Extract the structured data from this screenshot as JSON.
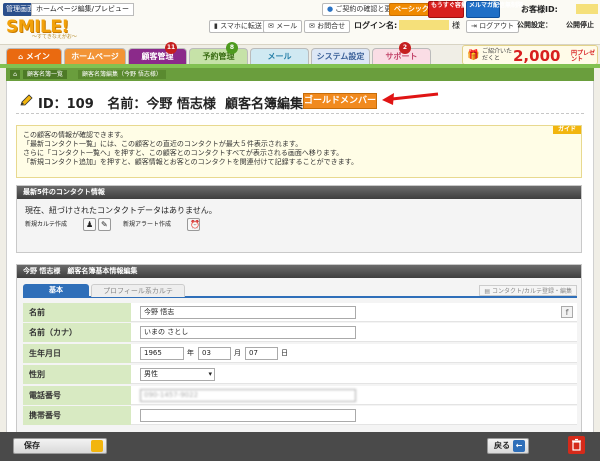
{
  "header": {
    "admin_label": "管理画面",
    "preview_label": "ホームページ編集/プレビュー",
    "logo": "SMILE!",
    "logo_sub": "～すてきなえがお～",
    "contract_label": "ご契約の確認と更新",
    "plan_label": "ベーシック",
    "urgent_label": "もうすぐ容量オーバー",
    "mailmag_label": "メルマガ配信無制限",
    "customer_id_label": "お客様ID:",
    "phone_notify_label": "スマホに転送",
    "mail_label": "メール",
    "inquiry_label": "お問合せ",
    "login_label": "ログイン名:",
    "login_suffix": "様",
    "logout_label": "ログアウト",
    "public_label": "公開設定：",
    "public_value": "公開停止"
  },
  "tabs": [
    {
      "label": "メイン",
      "badge": ""
    },
    {
      "label": "ホームページ",
      "badge": ""
    },
    {
      "label": "顧客管理",
      "badge": "11"
    },
    {
      "label": "予約管理",
      "badge": "8"
    },
    {
      "label": "メール",
      "badge": ""
    },
    {
      "label": "システム設定",
      "badge": ""
    },
    {
      "label": "サポート",
      "badge": "2"
    }
  ],
  "promo": {
    "small": "ご紹介いただくと",
    "amount": "2,000",
    "unit": "円プレゼント"
  },
  "breadcrumb": [
    "顧客名簿一覧",
    "顧客名簿編集（今野 悟志様）"
  ],
  "title": {
    "id_label": "ID：109",
    "name_label": "名前：今野 悟志様",
    "page_label": "顧客名簿編集",
    "member_badge": "ゴールドメンバー"
  },
  "guide": {
    "tag": "ガイド",
    "lines": [
      "この顧客の情報が確認できます。",
      "「最新コンタクト一覧」には、この顧客との直近のコンタクトが最大５件表示されます。",
      "さらに「コンタクト一覧へ」を押すと、この顧客とのコンタクトすべてが表示される画面へ移ります。",
      "「新規コンタクト追加」を押すと、顧客情報とお客とのコンタクトを関連付けて記録することができます。"
    ]
  },
  "contact": {
    "heading": "最新5件のコンタクト情報",
    "empty_text": "現在、紐づけされたコンタクトデータはありません。",
    "new_karte": "新規カルテ作成",
    "new_alert": "新規アラート作成"
  },
  "basic": {
    "heading": "今野 悟志様　顧客名簿基本情報編集",
    "tab_basic": "基本",
    "tab_profile": "プロフィール系カルテ",
    "tab_right": "コンタクト/カルテ登録・編集",
    "fields": {
      "name_label": "名前",
      "name_value": "今野 悟志",
      "kana_label": "名前（カナ）",
      "kana_value": "いまの さとし",
      "birth_label": "生年月日",
      "birth_year": "1965",
      "year_unit": "年",
      "birth_month": "03",
      "month_unit": "月",
      "birth_day": "07",
      "day_unit": "日",
      "gender_label": "性別",
      "gender_value": "男性",
      "phone_label": "電話番号",
      "phone_value": "090-1457-9022",
      "mobile_label": "携帯番号",
      "mobile_value": ""
    }
  },
  "footer": {
    "save_label": "保存",
    "back_label": "戻る"
  },
  "colors": {
    "accent_orange": "#f18a1e",
    "nav_green": "#6a9e3d",
    "label_green": "#d8eac2",
    "tab_blue": "#2f6fb9"
  }
}
